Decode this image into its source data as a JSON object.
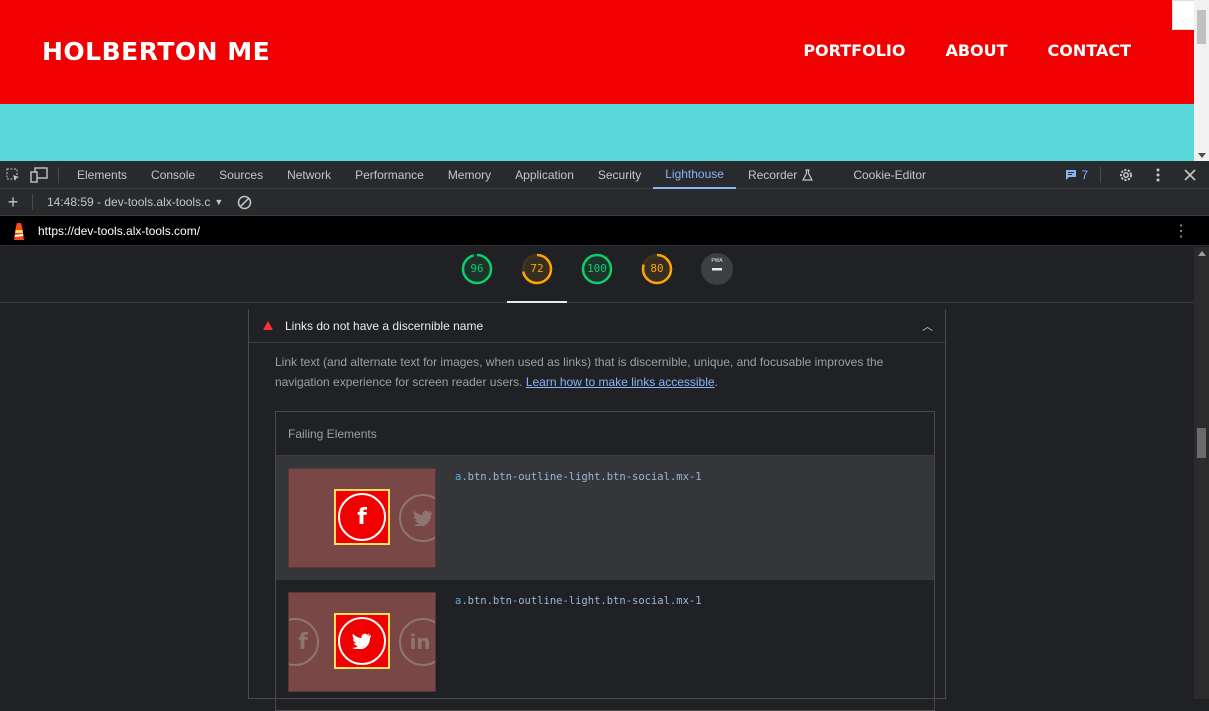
{
  "site": {
    "logo": "HOLBERTON ME",
    "nav": [
      "PORTFOLIO",
      "ABOUT",
      "CONTACT"
    ],
    "colors": {
      "header": "#f00000",
      "hero": "#5ad7da"
    }
  },
  "devtools": {
    "tabs": [
      "Elements",
      "Console",
      "Sources",
      "Network",
      "Performance",
      "Memory",
      "Application",
      "Security",
      "Lighthouse",
      "Recorder",
      "Cookie-Editor"
    ],
    "active_tab": "Lighthouse",
    "message_count": "7",
    "report_selector": "14:48:59 - dev-tools.alx-tools.c",
    "url": "https://dev-tools.alx-tools.com/"
  },
  "lighthouse": {
    "scores": [
      {
        "value": "96",
        "color": "#0cce6b",
        "fraction": 0.96
      },
      {
        "value": "72",
        "color": "#ffa400",
        "fraction": 0.72
      },
      {
        "value": "100",
        "color": "#0cce6b",
        "fraction": 1.0
      },
      {
        "value": "80",
        "color": "#ffa400",
        "fraction": 0.8
      }
    ],
    "pwa_label": "PWA",
    "audit": {
      "title": "Links do not have a discernible name",
      "description_text": "Link text (and alternate text for images, when used as links) that is discernible, unique, and focusable improves the navigation experience for screen reader users. ",
      "learn_more": "Learn how to make links accessible",
      "failing_title": "Failing Elements",
      "rows": [
        {
          "tag": "a",
          "selector": ".btn.btn-outline-light.btn-social.mx-1",
          "highlight_icon": "facebook-icon"
        },
        {
          "tag": "a",
          "selector": ".btn.btn-outline-light.btn-social.mx-1",
          "highlight_icon": "twitter-icon"
        }
      ]
    }
  }
}
